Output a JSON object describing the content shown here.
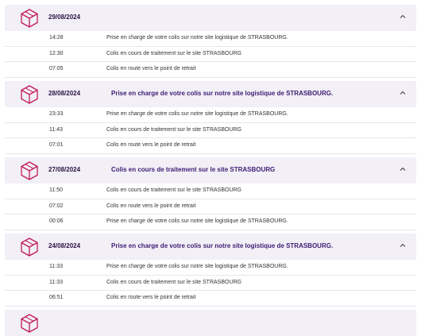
{
  "colors": {
    "header_bg": "#f2eff7",
    "accent": "#c2185b",
    "heading_text": "#3c1d71"
  },
  "icons": {
    "package": "package-icon",
    "collapse": "chevron-up-icon"
  },
  "days": [
    {
      "date": "29/08/2024",
      "headline": "",
      "events": [
        {
          "time": "14:28",
          "text": "Prise en charge de votre colis sur notre site logistique de STRASBOURG."
        },
        {
          "time": "12:30",
          "text": "Colis en cours de traitement sur le site STRASBOURG"
        },
        {
          "time": "07:05",
          "text": "Colis en route vers le point de retrait"
        }
      ]
    },
    {
      "date": "28/08/2024",
      "headline": "Prise en charge de votre colis sur notre site logistique de STRASBOURG.",
      "events": [
        {
          "time": "23:33",
          "text": "Prise en charge de votre colis sur notre site logistique de STRASBOURG."
        },
        {
          "time": "11:43",
          "text": "Colis en cours de traitement sur le site STRASBOURG"
        },
        {
          "time": "07:01",
          "text": "Colis en route vers le point de retrait"
        }
      ]
    },
    {
      "date": "27/08/2024",
      "headline": "Colis en cours de traitement sur le site STRASBOURG",
      "events": [
        {
          "time": "11:50",
          "text": "Colis en cours de traitement sur le site STRASBOURG"
        },
        {
          "time": "07:02",
          "text": "Colis en route vers le point de retrait"
        },
        {
          "time": "00:06",
          "text": "Prise en charge de votre colis sur notre site logistique de STRASBOURG."
        }
      ]
    },
    {
      "date": "24/08/2024",
      "headline": "Prise en charge de votre colis sur notre site logistique de STRASBOURG.",
      "events": [
        {
          "time": "11:33",
          "text": "Prise en charge de votre colis sur notre site logistique de STRASBOURG."
        },
        {
          "time": "11:33",
          "text": "Colis en cours de traitement sur le site STRASBOURG"
        },
        {
          "time": "06:51",
          "text": "Colis en route vers le point de retrait"
        }
      ]
    },
    {
      "date": "",
      "headline": "",
      "events": []
    }
  ]
}
